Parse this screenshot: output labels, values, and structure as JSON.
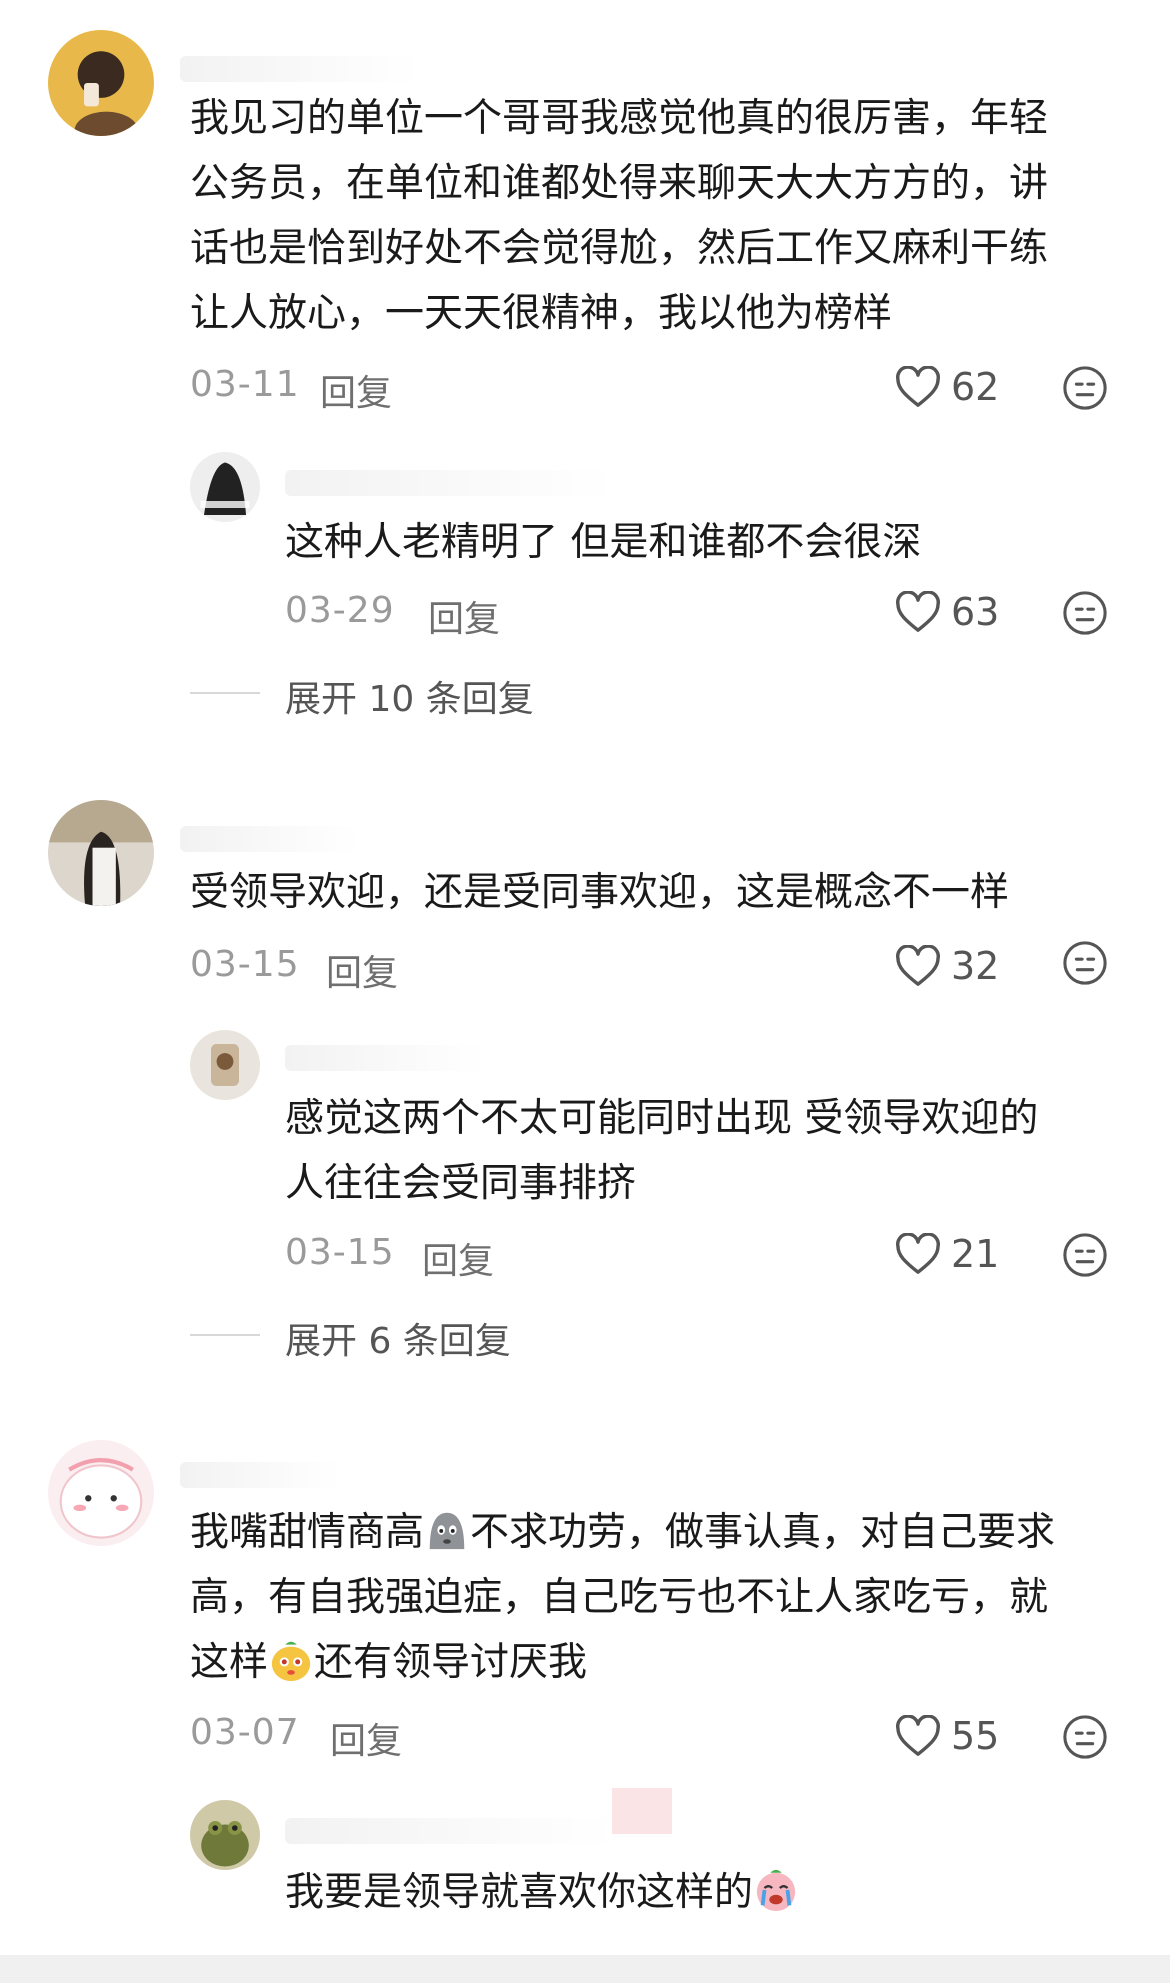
{
  "comments": [
    {
      "lines": [
        "我见习的单位一个哥哥我感觉他真的很厉害，年轻",
        "公务员，在单位和谁都处得来聊天大大方方的，讲",
        "话也是恰到好处不会觉得尬，然后工作又麻利干练",
        "让人放心，一天天很精神，我以他为榜样"
      ],
      "date": "03-11",
      "reply": "回复",
      "likes": "62",
      "replies": [
        {
          "lines": [
            "这种人老精明了 但是和谁都不会很深"
          ],
          "date": "03-29",
          "reply": "回复",
          "likes": "63"
        }
      ],
      "expand": "展开 10 条回复"
    },
    {
      "lines": [
        "受领导欢迎，还是受同事欢迎，这是概念不一样"
      ],
      "date": "03-15",
      "reply": "回复",
      "likes": "32",
      "replies": [
        {
          "lines": [
            "感觉这两个不太可能同时出现  受领导欢迎的",
            "人往往会受同事排挤"
          ],
          "date": "03-15",
          "reply": "回复",
          "likes": "21"
        }
      ],
      "expand": "展开 6 条回复"
    },
    {
      "line1_a": "我嘴甜情商高",
      "line1_b": "不求功劳，做事认真，对自己要求",
      "line2": "高，有自我强迫症，自己吃亏也不让人家吃亏，就",
      "line3_a": "这样",
      "line3_b": "还有领导讨厌我",
      "date": "03-07",
      "reply": "回复",
      "likes": "55",
      "replies": [
        {
          "text": "我要是领导就喜欢你这样的"
        }
      ]
    }
  ],
  "colors": {
    "text": "#1a1a1a",
    "meta": "#9a9a9a",
    "icon": "#555555"
  }
}
